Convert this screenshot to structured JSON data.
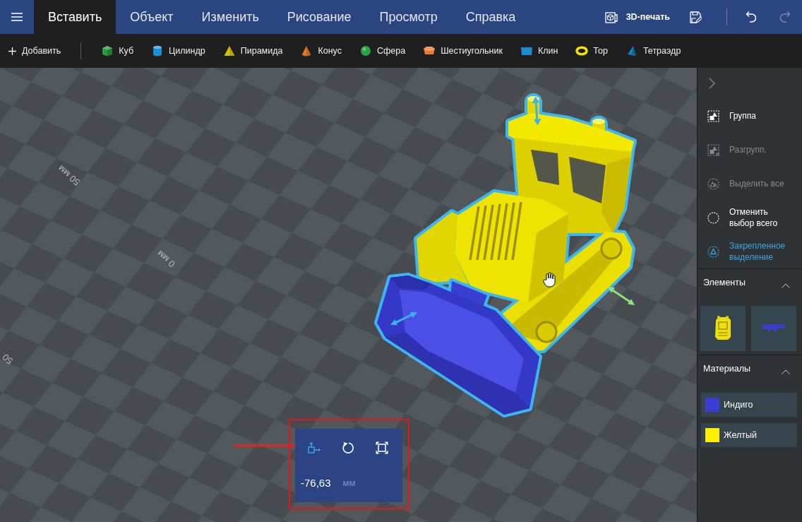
{
  "menu_bar": {
    "tabs": [
      {
        "label": "Вставить",
        "selected": true
      },
      {
        "label": "Объект",
        "selected": false
      },
      {
        "label": "Изменить",
        "selected": false
      },
      {
        "label": "Рисование",
        "selected": false
      },
      {
        "label": "Просмотр",
        "selected": false
      },
      {
        "label": "Справка",
        "selected": false
      }
    ],
    "actions": [
      {
        "kind": "print",
        "label": "3D-печать",
        "disabled": false
      },
      {
        "kind": "save",
        "disabled": false
      },
      {
        "kind": "undo",
        "disabled": false
      },
      {
        "kind": "redo",
        "disabled": true
      }
    ]
  },
  "insert_toolbar": {
    "add_label": "Добавить",
    "shapes": [
      {
        "kind": "cube",
        "label": "Куб",
        "color": "#2e9c3b"
      },
      {
        "kind": "cylinder",
        "label": "Цилиндр",
        "color": "#1b8fd6"
      },
      {
        "kind": "pyramid",
        "label": "Пирамида",
        "color": "#d4c400"
      },
      {
        "kind": "cone",
        "label": "Конус",
        "color": "#e2782b"
      },
      {
        "kind": "sphere",
        "label": "Сфера",
        "color": "#27a343"
      },
      {
        "kind": "hexagon",
        "label": "Шестиугольник",
        "color": "#ea7a34"
      },
      {
        "kind": "wedge",
        "label": "Клин",
        "color": "#1b8dd0"
      },
      {
        "kind": "torus",
        "label": "Тор",
        "color": "#f2e400"
      },
      {
        "kind": "tetrahedron",
        "label": "Тетраэдр",
        "color": "#1b80bd"
      }
    ]
  },
  "viewport": {
    "grid_labels": [
      "50 мм",
      "0 мм",
      "50"
    ]
  },
  "transform_panel": {
    "tools": [
      {
        "kind": "move",
        "selected": true
      },
      {
        "kind": "rotate",
        "selected": false
      },
      {
        "kind": "scale",
        "selected": false
      }
    ],
    "value": "-76,63",
    "unit": "мм"
  },
  "side_panel": {
    "actions": [
      {
        "kind": "group",
        "label": "Группа",
        "disabled": false,
        "on": false
      },
      {
        "kind": "ungroup",
        "label": "Разгрупп.",
        "disabled": true,
        "on": false
      },
      {
        "kind": "select_all",
        "label": "Выделить все",
        "disabled": true,
        "on": false
      },
      {
        "kind": "deselect",
        "label": "Отменить выбор всего",
        "disabled": false,
        "on": false
      },
      {
        "kind": "sticky",
        "label": "Закрепленное выделение",
        "disabled": false,
        "on": true
      }
    ],
    "elements": {
      "title": "Элементы",
      "expanded": true,
      "items": [
        {
          "kind": "body"
        },
        {
          "kind": "bucket"
        }
      ]
    },
    "materials": {
      "title": "Материалы",
      "expanded": true,
      "items": [
        {
          "label": "Индиго",
          "color": "#3a3fd3"
        },
        {
          "label": "Желтый",
          "color": "#ffee00"
        }
      ]
    }
  }
}
